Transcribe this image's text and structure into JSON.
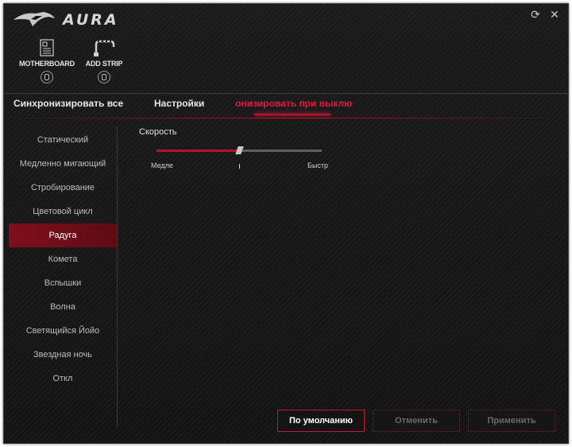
{
  "app": {
    "title": "AURA"
  },
  "window_controls": {
    "refresh_icon": "refresh-icon",
    "close_icon": "close-icon",
    "refresh_glyph": "⟳",
    "close_glyph": "✕"
  },
  "devices": [
    {
      "label": "MOTHERBOARD",
      "icon": "motherboard-icon"
    },
    {
      "label": "ADD STRIP",
      "icon": "led-strip-icon"
    }
  ],
  "tabs": [
    {
      "label": "Синхронизировать все",
      "active": false
    },
    {
      "label": "Настройки",
      "active": false
    },
    {
      "label": "онизировать при выклю",
      "active": true
    }
  ],
  "effects": [
    {
      "label": "Статический"
    },
    {
      "label": "Медленно мигающий"
    },
    {
      "label": "Стробирование"
    },
    {
      "label": "Цветовой цикл"
    },
    {
      "label": "Радуга",
      "selected": true
    },
    {
      "label": "Комета"
    },
    {
      "label": "Вспышки"
    },
    {
      "label": "Волна"
    },
    {
      "label": "Светящийся Йойо"
    },
    {
      "label": "Звездная ночь"
    },
    {
      "label": "Откл"
    }
  ],
  "speed": {
    "label": "Скорость",
    "min_label": "Медле",
    "max_label": "Быстр",
    "value_fraction": 0.5
  },
  "buttons": {
    "default": "По умолчанию",
    "cancel": "Отменить",
    "apply": "Применить"
  },
  "colors": {
    "accent": "#c0122f",
    "selected_bg": "#7e0f1c",
    "window_bg": "#171718"
  }
}
